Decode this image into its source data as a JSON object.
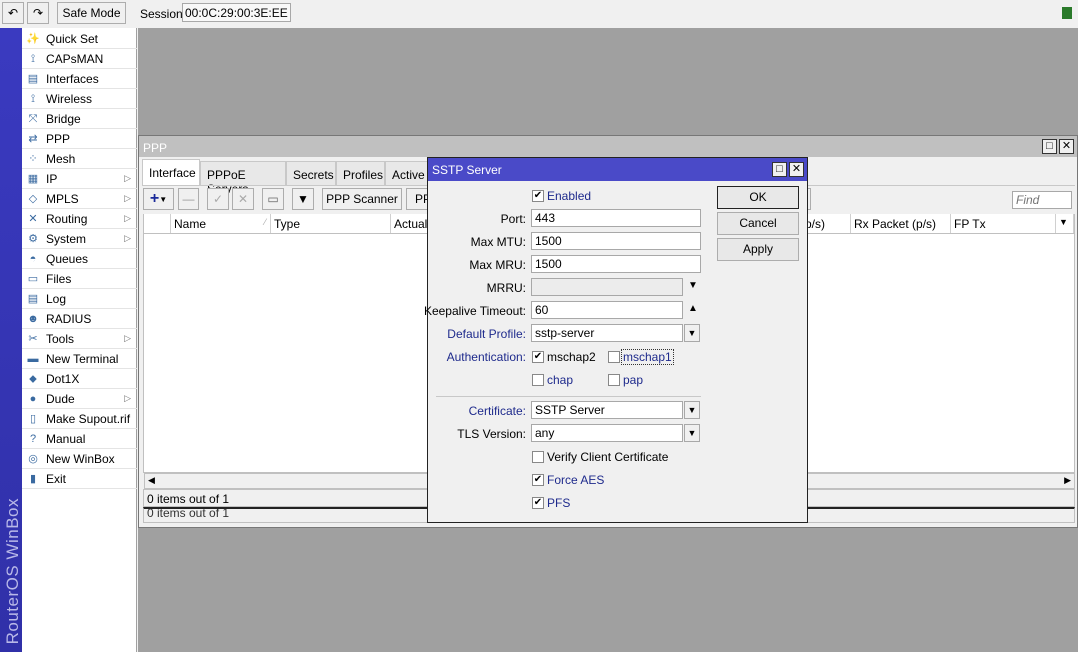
{
  "toolbar": {
    "undo_icon": "undo-icon",
    "redo_icon": "redo-icon",
    "safe_mode": "Safe Mode",
    "session_label": "Session:",
    "session_value": "00:0C:29:00:3E:EE"
  },
  "brand": "RouterOS WinBox",
  "menu": [
    {
      "label": "Quick Set",
      "icon": "wand-icon"
    },
    {
      "label": "CAPsMAN",
      "icon": "antenna-icon"
    },
    {
      "label": "Interfaces",
      "icon": "interfaces-icon"
    },
    {
      "label": "Wireless",
      "icon": "antenna-icon"
    },
    {
      "label": "Bridge",
      "icon": "bridge-icon"
    },
    {
      "label": "PPP",
      "icon": "ppp-icon"
    },
    {
      "label": "Mesh",
      "icon": "mesh-icon"
    },
    {
      "label": "IP",
      "icon": "ip-icon",
      "submenu": true
    },
    {
      "label": "MPLS",
      "icon": "mpls-icon",
      "submenu": true
    },
    {
      "label": "Routing",
      "icon": "routing-icon",
      "submenu": true
    },
    {
      "label": "System",
      "icon": "gear-icon",
      "submenu": true
    },
    {
      "label": "Queues",
      "icon": "queues-icon"
    },
    {
      "label": "Files",
      "icon": "folder-icon"
    },
    {
      "label": "Log",
      "icon": "log-icon"
    },
    {
      "label": "RADIUS",
      "icon": "users-icon"
    },
    {
      "label": "Tools",
      "icon": "tools-icon",
      "submenu": true
    },
    {
      "label": "New Terminal",
      "icon": "terminal-icon"
    },
    {
      "label": "Dot1X",
      "icon": "dot1x-icon"
    },
    {
      "label": "Dude",
      "icon": "dude-icon",
      "submenu": true
    },
    {
      "label": "Make Supout.rif",
      "icon": "file-icon"
    },
    {
      "label": "Manual",
      "icon": "help-icon"
    },
    {
      "label": "New WinBox",
      "icon": "winbox-icon"
    },
    {
      "label": "Exit",
      "icon": "exit-icon"
    }
  ],
  "ppp": {
    "title": "PPP",
    "tabs": [
      "Interface",
      "PPPoE Servers",
      "Secrets",
      "Profiles",
      "Active C"
    ],
    "scanner": "PPP Scanner",
    "pp_btn": "PP",
    "find_placeholder": "Find",
    "columns_left": [
      "Name",
      "Type",
      "Actual"
    ],
    "columns_right": [
      "p/s)",
      "Rx Packet (p/s)",
      "FP Tx"
    ],
    "status": "0 items out of 1",
    "status2": "0 items out of 1"
  },
  "dialog": {
    "title": "SSTP Server",
    "enabled": "Enabled",
    "port_label": "Port:",
    "port": "443",
    "mtu_label": "Max MTU:",
    "mtu": "1500",
    "mru_label": "Max MRU:",
    "mru": "1500",
    "mrru_label": "MRRU:",
    "mrru": "",
    "keepalive_label": "Keepalive Timeout:",
    "keepalive": "60",
    "profile_label": "Default Profile:",
    "profile": "sstp-server",
    "auth_label": "Authentication:",
    "mschap2": "mschap2",
    "mschap1": "mschap1",
    "chap": "chap",
    "pap": "pap",
    "cert_label": "Certificate:",
    "cert": "SSTP Server",
    "tls_label": "TLS Version:",
    "tls": "any",
    "verify": "Verify Client Certificate",
    "force_aes": "Force AES",
    "pfs": "PFS",
    "ok": "OK",
    "cancel": "Cancel",
    "apply": "Apply",
    "checks": {
      "enabled": true,
      "mschap2": true,
      "mschap1": false,
      "chap": false,
      "pap": false,
      "verify": false,
      "force_aes": true,
      "pfs": true
    }
  },
  "colors": {
    "brand": "#3a3ac0",
    "dialog_title": "#4a4ac8",
    "label_blue": "#1e2a8c",
    "desktop": "#a0a0a0"
  }
}
